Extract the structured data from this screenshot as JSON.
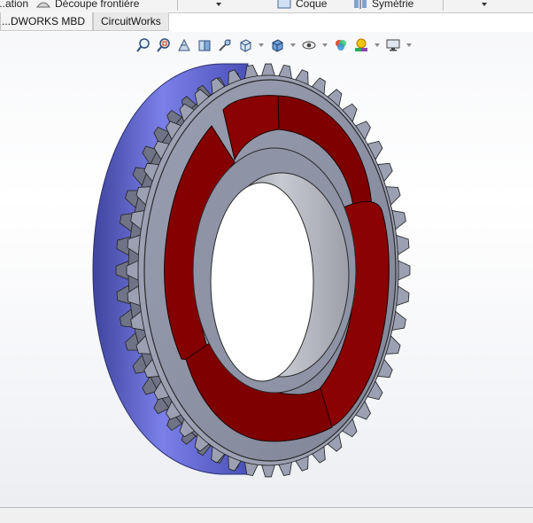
{
  "ribbon": {
    "item1_label": "...ation",
    "item2_label": "Découpe frontière",
    "item3_label": "Coque",
    "item4_label": "Symétrie"
  },
  "tabs": [
    {
      "label": "...DWORKS MBD"
    },
    {
      "label": "CircuitWorks"
    }
  ],
  "hud_icons": [
    "zoom-to-fit-icon",
    "zoom-to-area-icon",
    "previous-view-icon",
    "section-view-icon",
    "dynamic-annotation-icon",
    "view-orientation-icon",
    "display-style-icon",
    "hide-show-items-icon",
    "edit-appearance-icon",
    "apply-scene-icon",
    "view-settings-icon"
  ],
  "colors": {
    "gear_gray": "#8f94a8",
    "gear_side_blue": "#5a5fc7",
    "insert_red": "#850000",
    "bore_gray": "#b2b4bd"
  },
  "model": {
    "teeth_count": 48
  }
}
